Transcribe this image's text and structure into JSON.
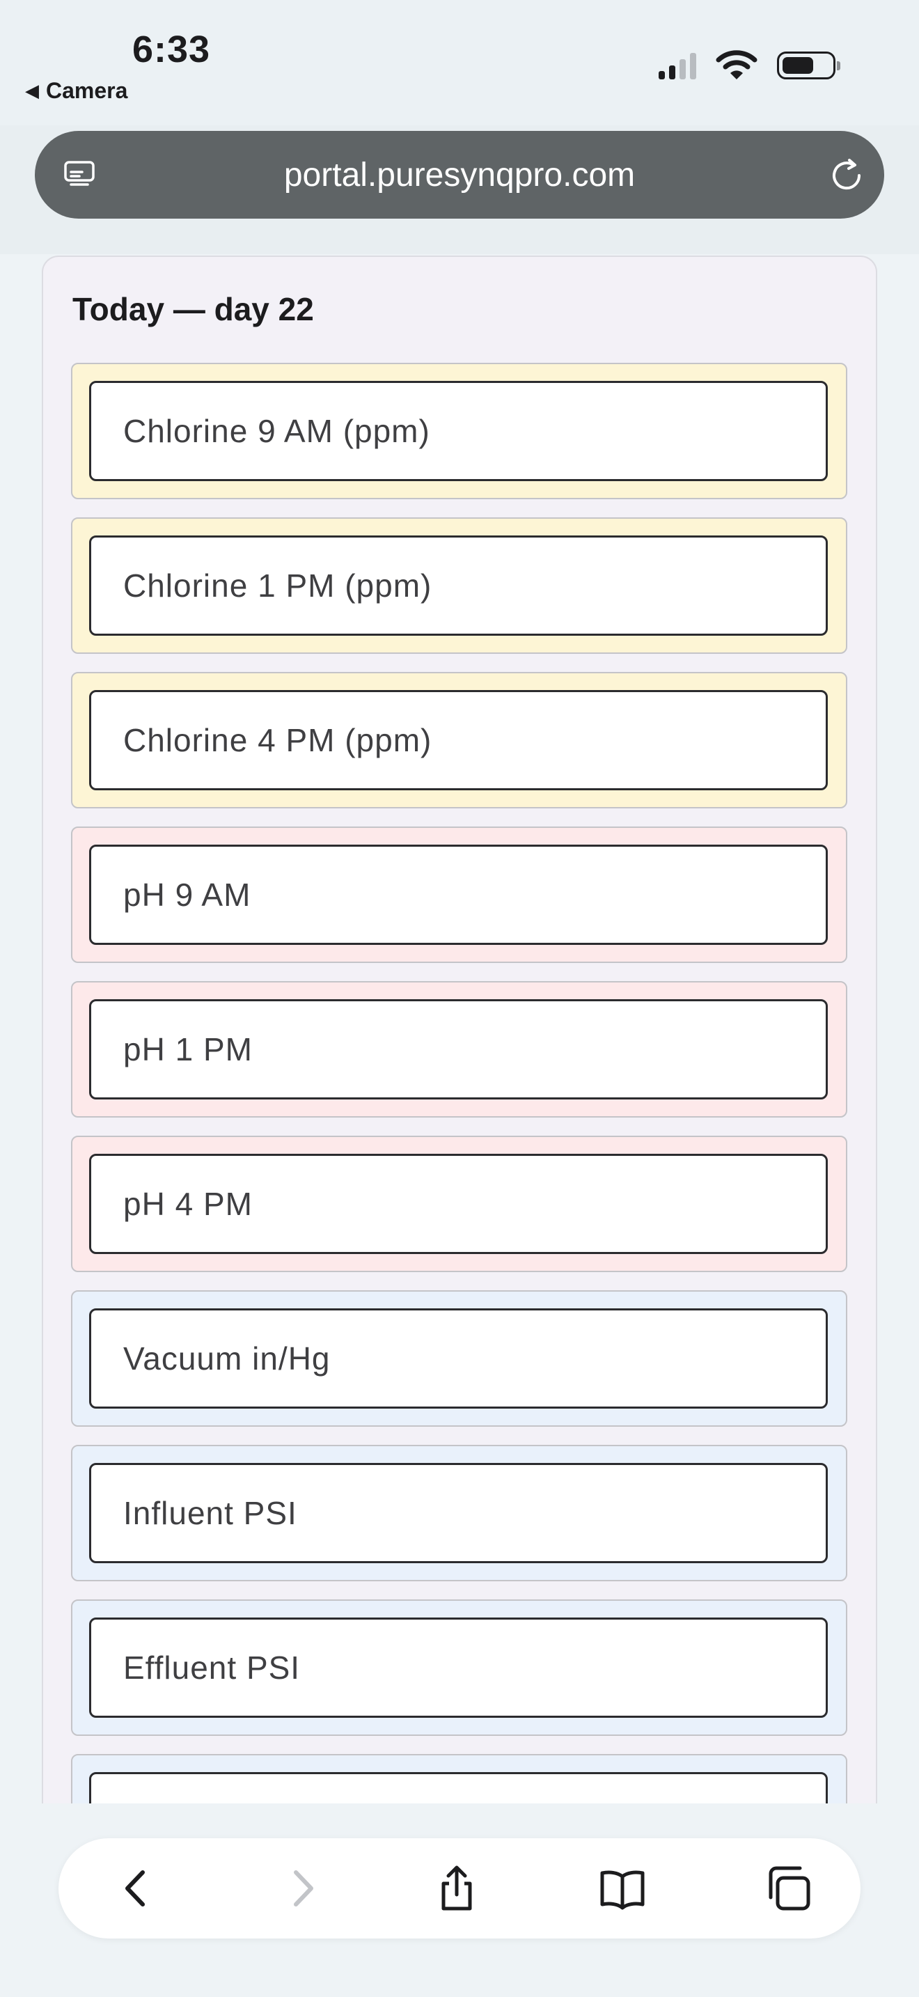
{
  "status_bar": {
    "time": "6:33",
    "back_app": "Camera",
    "icons": [
      "signal-icon",
      "wifi-icon",
      "battery-icon"
    ]
  },
  "browser": {
    "url": "portal.puresynqpro.com",
    "left_icon": "tabs-overview-icon",
    "right_icon": "reload-icon"
  },
  "form": {
    "title": "Today — day 22",
    "fields": [
      {
        "placeholder": "Chlorine 9 AM (ppm)",
        "value": "",
        "group_color": "#fdf5d5"
      },
      {
        "placeholder": "Chlorine 1 PM (ppm)",
        "value": "",
        "group_color": "#fdf5d5"
      },
      {
        "placeholder": "Chlorine 4 PM (ppm)",
        "value": "",
        "group_color": "#fdf5d5"
      },
      {
        "placeholder": "pH 9 AM",
        "value": "",
        "group_color": "#fde9ea"
      },
      {
        "placeholder": "pH 1 PM",
        "value": "",
        "group_color": "#fde9ea"
      },
      {
        "placeholder": "pH 4 PM",
        "value": "",
        "group_color": "#fde9ea"
      },
      {
        "placeholder": "Vacuum in/Hg",
        "value": "",
        "group_color": "#e9f1fb"
      },
      {
        "placeholder": "Influent PSI",
        "value": "",
        "group_color": "#e9f1fb"
      },
      {
        "placeholder": "Effluent PSI",
        "value": "",
        "group_color": "#e9f1fb"
      },
      {
        "placeholder": "",
        "value": "",
        "group_color": "#e9f1fb"
      }
    ]
  },
  "toolbar": {
    "buttons": [
      "back-icon",
      "forward-icon",
      "share-icon",
      "bookmarks-icon",
      "tabs-icon"
    ],
    "forward_enabled": false
  },
  "colors": {
    "accent_yellow": "#fdf5d5",
    "accent_pink": "#fde9ea",
    "accent_blue": "#e9f1fb",
    "url_bar": "#5f6466"
  }
}
